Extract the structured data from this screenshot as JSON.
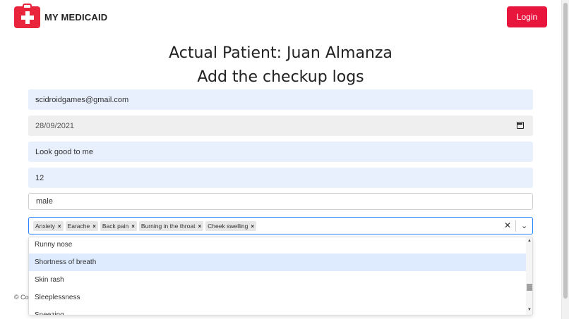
{
  "header": {
    "brand": "MY MEDICAID",
    "login_label": "Login"
  },
  "titles": {
    "patient": "Actual Patient: Juan Almanza",
    "subtitle": "Add the checkup logs"
  },
  "form": {
    "email": "scidroidgames@gmail.com",
    "date": "28/09/2021",
    "notes": "Look good to me",
    "number": "12",
    "gender": "male"
  },
  "symptoms": {
    "selected": [
      "Anxiety",
      "Earache",
      "Back pain",
      "Burning in the throat",
      "Cheek swelling"
    ],
    "remove_glyph": "×",
    "clear_glyph": "✕",
    "chevron_glyph": "⌄",
    "options": [
      "Runny nose",
      "Shortness of breath",
      "Skin rash",
      "Sleeplessness",
      "Sneezing"
    ],
    "highlighted": "Shortness of breath"
  },
  "footer": {
    "fragment": "© Co"
  },
  "colors": {
    "brand_red": "#e8253c",
    "button_red": "#e8153c",
    "input_blue": "#e8f0fe",
    "focus_blue": "#2684ff",
    "option_highlight": "#deebff"
  }
}
